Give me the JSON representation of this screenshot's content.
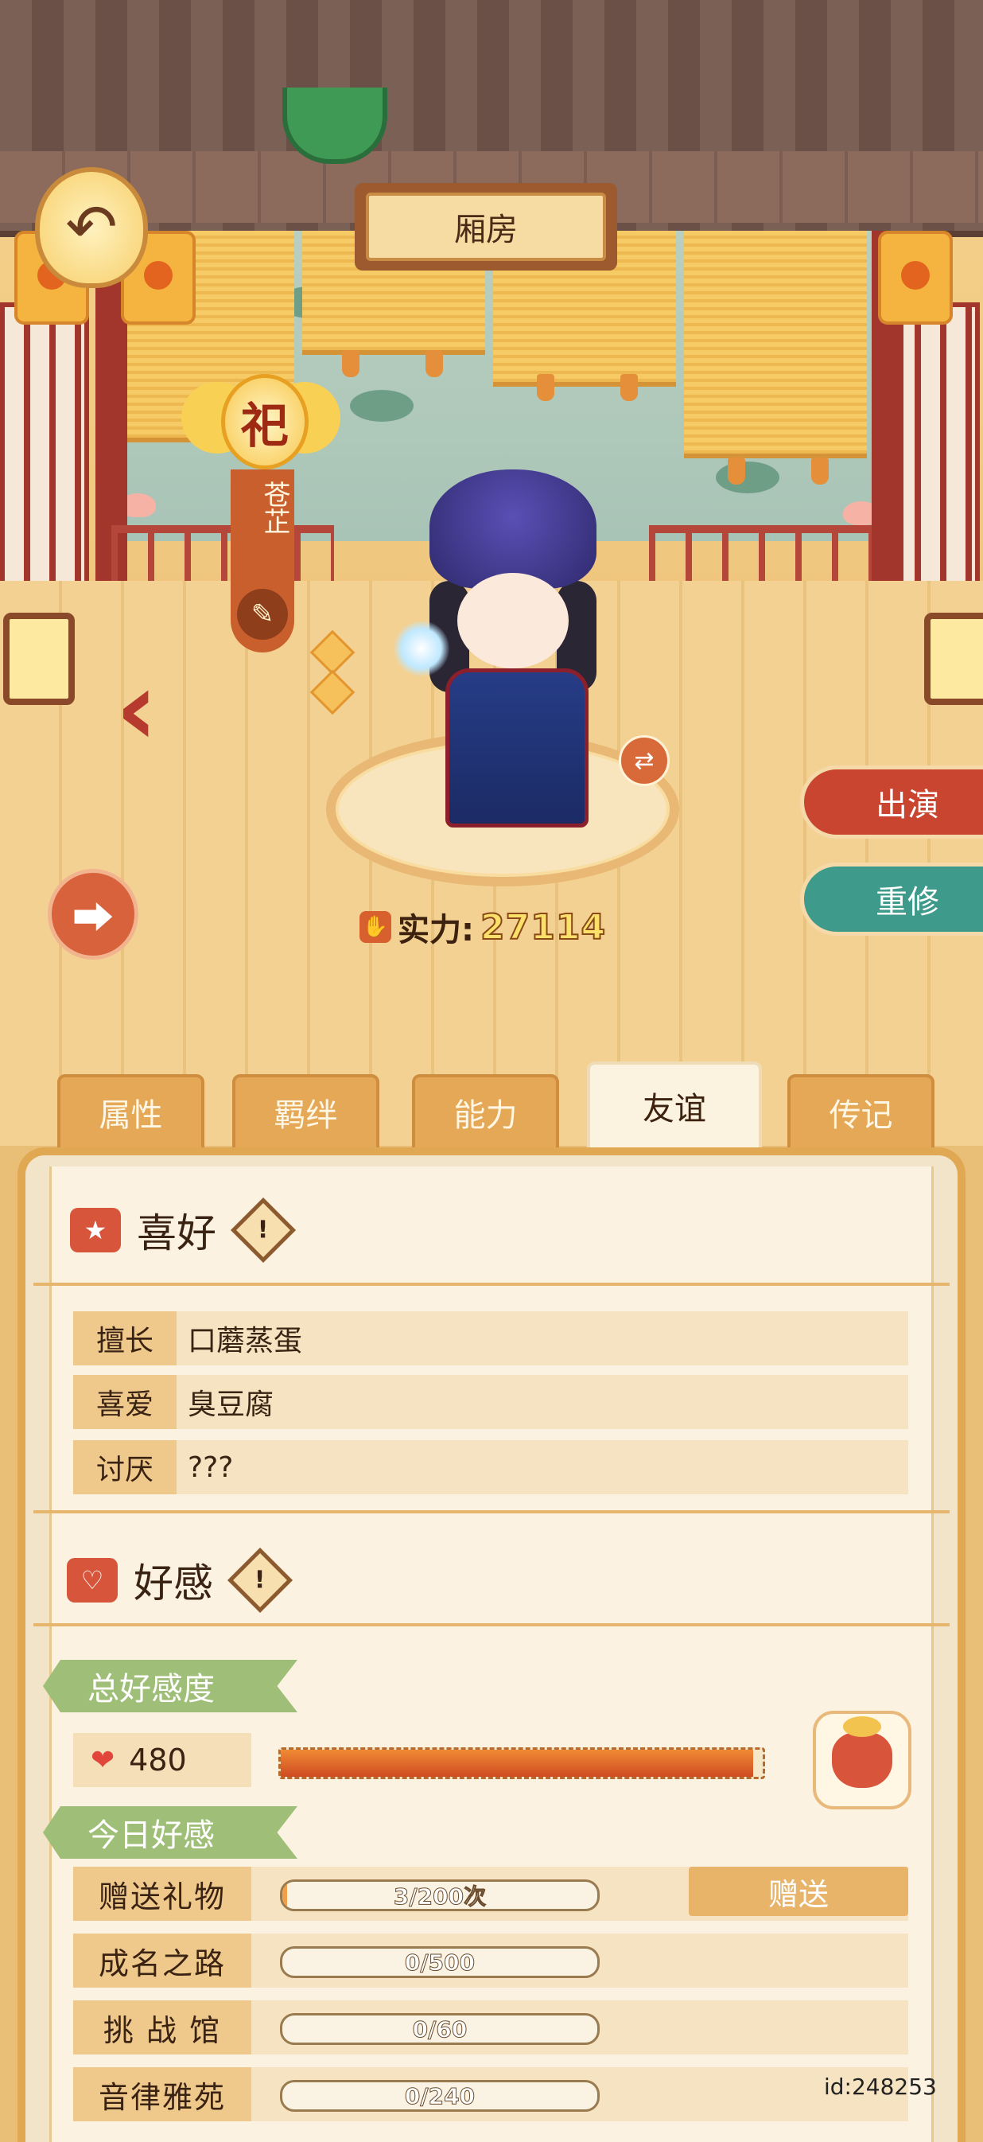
{
  "header": {
    "title": "厢房",
    "back_icon": "arrow-back-icon"
  },
  "character": {
    "rank_glyph": "祀",
    "name": "苍芷",
    "power_label": "实力:",
    "power_value": "27114"
  },
  "actions": {
    "perform_label": "出演",
    "retrain_label": "重修"
  },
  "tabs": [
    {
      "label": "属性",
      "active": false
    },
    {
      "label": "羁绊",
      "active": false
    },
    {
      "label": "能力",
      "active": false
    },
    {
      "label": "友谊",
      "active": true
    },
    {
      "label": "传记",
      "active": false
    }
  ],
  "preferences": {
    "title": "喜好",
    "rows": [
      {
        "key": "擅长",
        "value": "口蘑蒸蛋"
      },
      {
        "key": "喜爱",
        "value": "臭豆腐"
      },
      {
        "key": "讨厌",
        "value": "???"
      }
    ]
  },
  "affection": {
    "title": "好感",
    "total_label": "总好感度",
    "total_value": "480",
    "total_progress": 0.98,
    "today_label": "今日好感",
    "daily": [
      {
        "key": "赠送礼物",
        "text": "3/200次",
        "progress": 0.015
      },
      {
        "key": "成名之路",
        "text": "0/500",
        "progress": 0
      },
      {
        "key": "挑 战 馆",
        "text": "0/60",
        "progress": 0
      },
      {
        "key": "音律雅苑",
        "text": "0/240",
        "progress": 0
      }
    ],
    "gift_button": "赠送"
  },
  "footer": {
    "user_id": "id:248253"
  },
  "colors": {
    "accent_red": "#c9452f",
    "accent_teal": "#3e9a8a",
    "panel_border": "#e0a853"
  }
}
